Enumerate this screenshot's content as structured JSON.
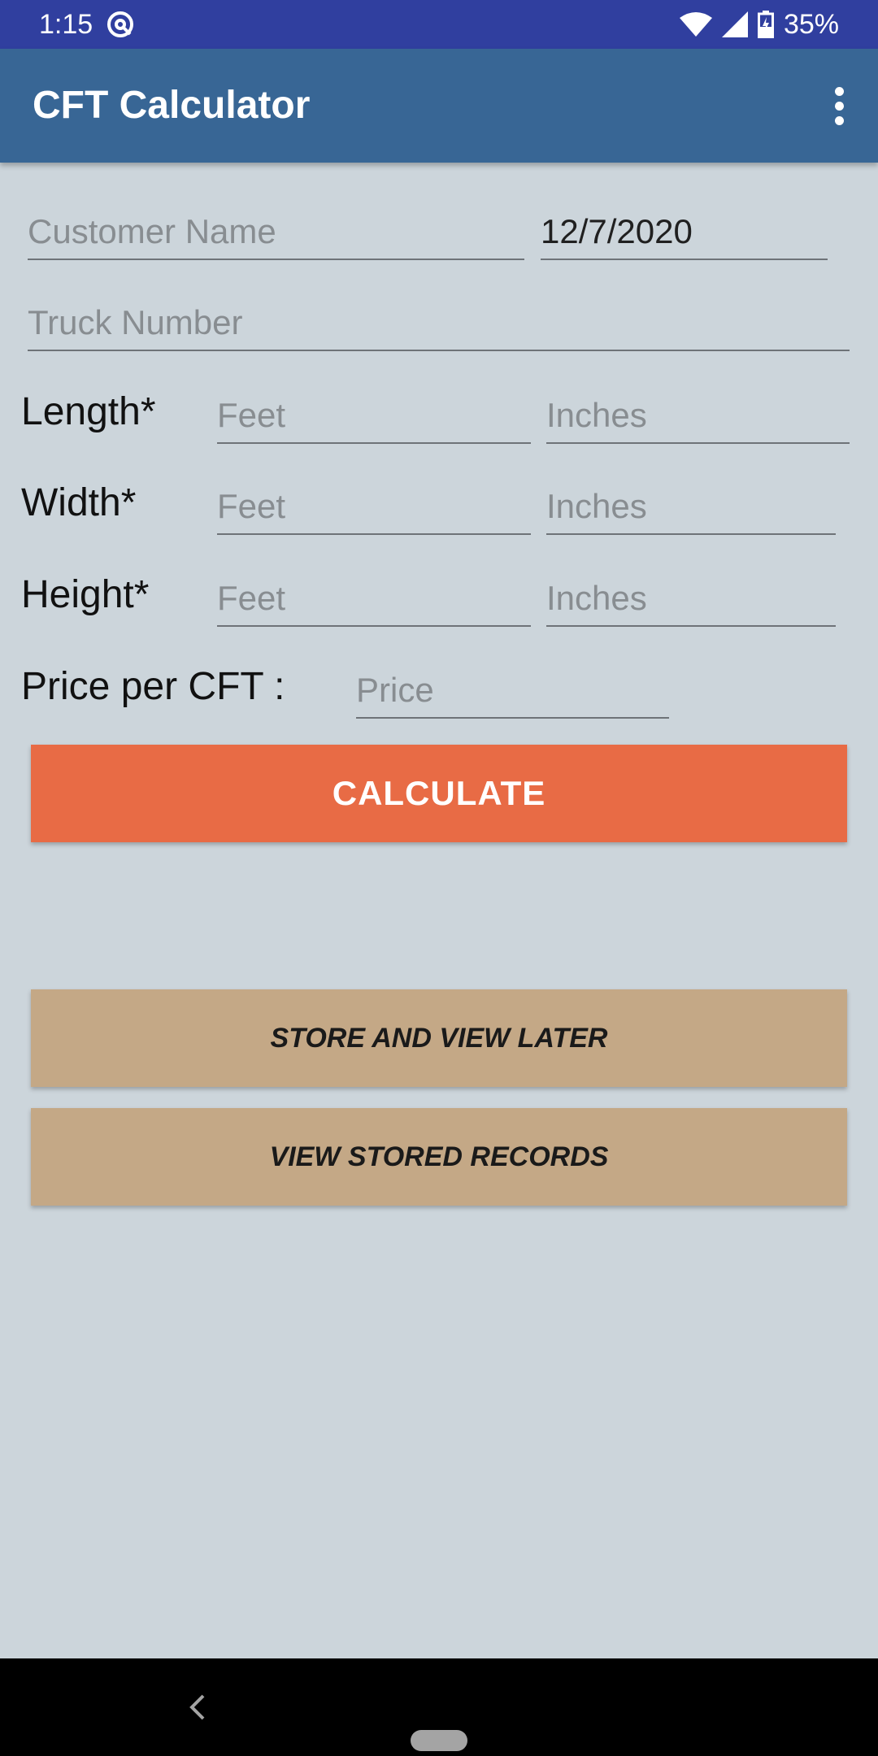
{
  "status_bar": {
    "time": "1:15",
    "battery": "35%",
    "icons": [
      "at-sign-icon",
      "wifi-icon",
      "signal-icon",
      "battery-charging-icon"
    ]
  },
  "app_bar": {
    "title": "CFT Calculator",
    "menu_icon": "more-vertical-icon"
  },
  "form": {
    "customer_name": {
      "placeholder": "Customer Name",
      "value": ""
    },
    "date": {
      "value": "12/7/2020"
    },
    "truck_number": {
      "placeholder": "Truck Number",
      "value": ""
    },
    "length": {
      "label": "Length*",
      "feet_placeholder": "Feet",
      "inches_placeholder": "Inches"
    },
    "width": {
      "label": "Width*",
      "feet_placeholder": "Feet",
      "inches_placeholder": "Inches"
    },
    "height": {
      "label": "Height*",
      "feet_placeholder": "Feet",
      "inches_placeholder": "Inches"
    },
    "price": {
      "label": "Price per CFT :",
      "placeholder": "Price"
    }
  },
  "buttons": {
    "calculate": "CALCULATE",
    "store": "STORE AND VIEW LATER",
    "view": "VIEW STORED RECORDS"
  },
  "colors": {
    "status_bar": "#303f9f",
    "app_bar": "#386695",
    "background": "#ccd5db",
    "calculate_button": "#e86b45",
    "secondary_button": "#c4a886"
  },
  "nav_bar": {
    "icons": [
      "back-icon",
      "home-pill-icon"
    ]
  }
}
